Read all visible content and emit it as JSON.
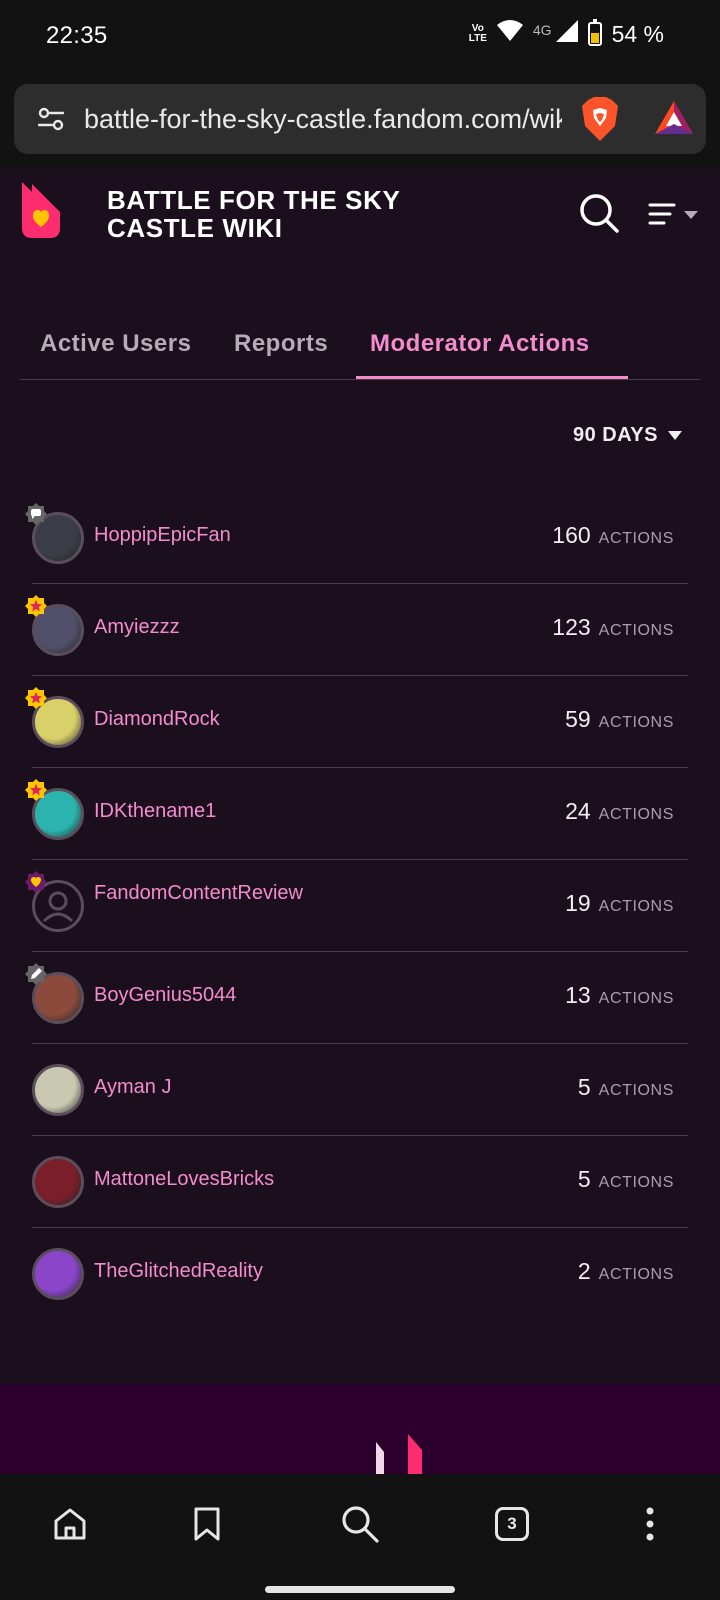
{
  "status_bar": {
    "time": "22:35",
    "volte": "Vo LTE",
    "network": "4G",
    "battery": "54 %",
    "battery_level": 0.54
  },
  "browser": {
    "url": "battle-for-the-sky-castle.fandom.com/wiki/Special:Analytics"
  },
  "wiki": {
    "title": "BATTLE FOR THE SKY CASTLE WIKI"
  },
  "tabs": [
    {
      "label": "Active Users",
      "active": false
    },
    {
      "label": "Reports",
      "active": false
    },
    {
      "label": "Moderator Actions",
      "active": true
    }
  ],
  "filter": {
    "period": "90 DAYS"
  },
  "actions_label": "ACTIONS",
  "users": [
    {
      "name": "HoppipEpicFan",
      "count": "160",
      "badge": "chat-moderator-icon",
      "avatar_color": "#3a3d47"
    },
    {
      "name": "Amyiezzz",
      "count": "123",
      "badge": "admin-star-icon",
      "avatar_color": "#50506a"
    },
    {
      "name": "DiamondRock",
      "count": "59",
      "badge": "admin-star-icon",
      "avatar_color": "#d9d06a"
    },
    {
      "name": "IDKthename1",
      "count": "24",
      "badge": "admin-star-icon",
      "avatar_color": "#2bb4ad"
    },
    {
      "name": "FandomContentReview",
      "count": "19",
      "badge": "staff-heart-icon",
      "avatar_color": "#1c0f1d"
    },
    {
      "name": "BoyGenius5044",
      "count": "13",
      "badge": "content-moderator-icon",
      "avatar_color": "#8b4a3c"
    },
    {
      "name": "Ayman J",
      "count": "5",
      "badge": "",
      "avatar_color": "#c9c8b0"
    },
    {
      "name": "MattoneLovesBricks",
      "count": "5",
      "badge": "",
      "avatar_color": "#7a1f2a"
    },
    {
      "name": "TheGlitchedReality",
      "count": "2",
      "badge": "",
      "avatar_color": "#8a45c8"
    }
  ],
  "bottom_nav": {
    "tab_count": "3"
  },
  "colors": {
    "accent": "#f28ccd",
    "background": "#1c0f1d",
    "fandom_pink": "#ff2d6f"
  }
}
